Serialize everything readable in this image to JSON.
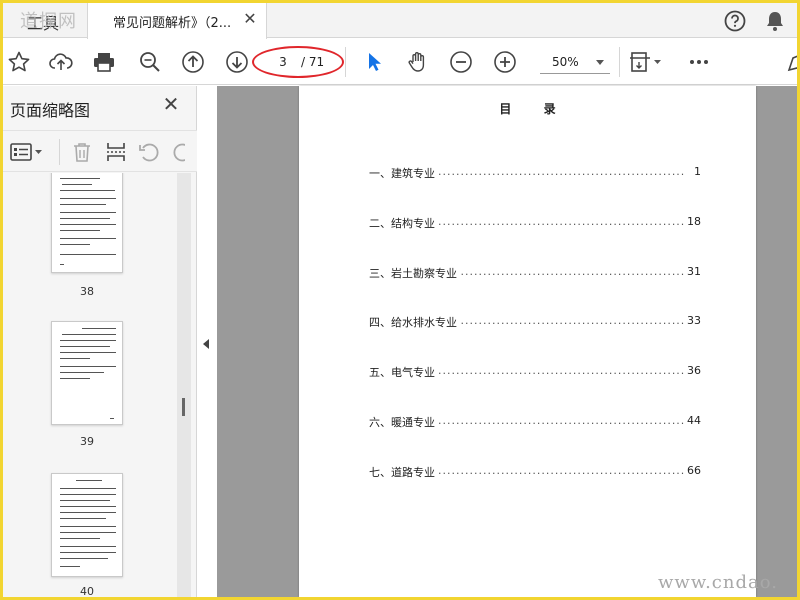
{
  "tabs": {
    "tools_label": "工具",
    "doc_label": "常见问题解析》（2...",
    "close_glyph": "✕"
  },
  "toolbar": {
    "current_page": "3",
    "total_pages": "/ 71",
    "zoom": "50%",
    "icons": [
      "star-icon",
      "upload-icon",
      "print-icon",
      "zoom-search-icon",
      "page-up-icon",
      "page-down-icon",
      "select-cursor-icon",
      "hand-icon",
      "zoom-out-icon",
      "zoom-in-icon",
      "page-fit-icon",
      "more-icon"
    ]
  },
  "sidebar": {
    "title": "页面缩略图",
    "close_glyph": "✕",
    "thumbnails": [
      {
        "label": "38"
      },
      {
        "label": "39"
      },
      {
        "label": "40"
      }
    ]
  },
  "document": {
    "toc_title": "目 录",
    "toc": [
      {
        "label": "一、建筑专业",
        "page": "1"
      },
      {
        "label": "二、结构专业",
        "page": "18"
      },
      {
        "label": "三、岩土勘察专业",
        "page": "31"
      },
      {
        "label": "四、给水排水专业",
        "page": "33"
      },
      {
        "label": "五、电气专业",
        "page": "36"
      },
      {
        "label": "六、暖通专业",
        "page": "44"
      },
      {
        "label": "七、道路专业",
        "page": "66"
      }
    ],
    "dots": "..................................................................................................."
  },
  "watermark": "www.cndao.",
  "watermark_top": "道探网",
  "colors": {
    "frame": "#f2d531",
    "viewer_bg": "#9a9a9a",
    "annotation": "#e0262b",
    "select_tool": "#1473e6"
  }
}
